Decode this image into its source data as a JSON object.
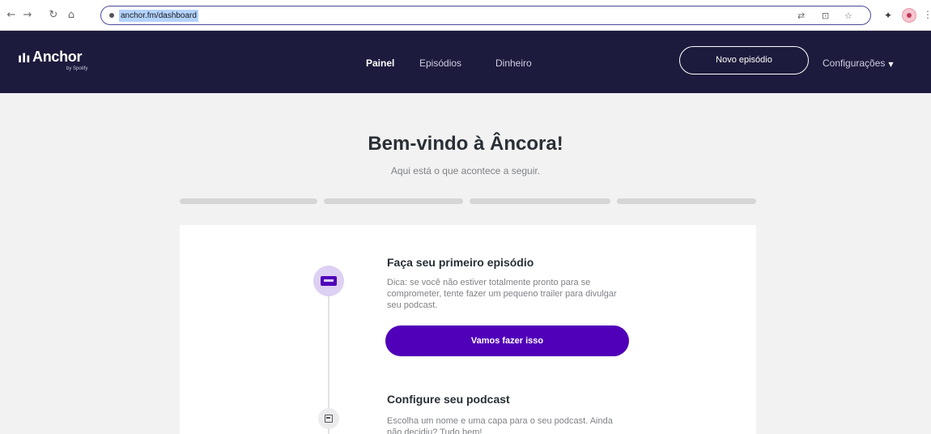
{
  "browser": {
    "back_icon": "arrow-left-icon",
    "forward_icon": "arrow-right-icon",
    "reload_icon": "reload-icon",
    "home_icon": "home-icon",
    "url": "anchor.fm/dashboard"
  },
  "header": {
    "logo_text": "Anchor",
    "logo_sub": "by Spotify",
    "nav": {
      "painel": "Painel",
      "episodios": "Episódios",
      "dinheiro": "Dinheiro"
    },
    "new_episode_label": "Novo episódio",
    "settings_label": "Configurações",
    "colors": {
      "background": "#1d1b3d",
      "accent": "#5000b9"
    }
  },
  "welcome": {
    "title": "Bem-vindo à Âncora!",
    "subtitle": "Aqui está o que acontece a seguir."
  },
  "progress": {
    "segments": 4,
    "completed": 0
  },
  "steps": [
    {
      "title": "Faça seu primeiro episódio",
      "description": "Dica: se você não estiver totalmente pronto para se comprometer, tente fazer um pequeno trailer para divulgar seu podcast.",
      "cta_label": "Vamos fazer isso",
      "icon": "video-icon"
    },
    {
      "title": "Configure seu podcast",
      "description": "Escolha um nome e uma capa para o seu podcast. Ainda não decidiu? Tudo bem!",
      "icon": "podcast-cover-icon"
    }
  ]
}
